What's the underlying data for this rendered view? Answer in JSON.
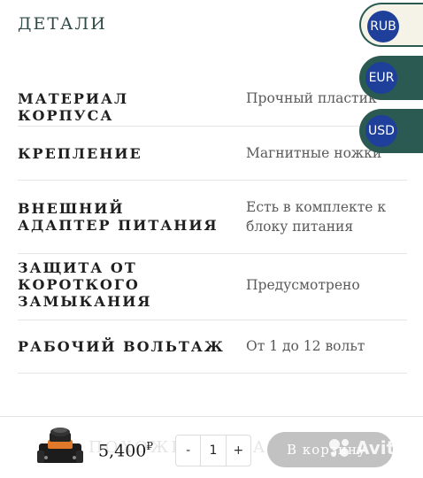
{
  "section": {
    "title": "ДЕТАЛИ"
  },
  "details": [
    {
      "label": "МАТЕРИАЛ КОРПУСА",
      "value": "Прочный пластик"
    },
    {
      "label": "КРЕПЛЕНИЕ",
      "value": "Магнитные ножки"
    },
    {
      "label": "ВНЕШНИЙ АДАПТЕР ПИТАНИЯ",
      "value": "Есть в комплекте к блоку питания"
    },
    {
      "label": "ЗАЩИТА ОТ КОРОТКОГО ЗАМЫКАНИЯ",
      "value": "Предусмотрено"
    },
    {
      "label": "РАБОЧИЙ ВОЛЬТАЖ",
      "value": "От 1 до 12 вольт"
    }
  ],
  "currencies": {
    "rub": "RUB",
    "eur": "EUR",
    "usd": "USD",
    "selected": "RUB"
  },
  "bottom_bar": {
    "price": "5,400",
    "currency_symbol": "₽",
    "decrement": "-",
    "quantity": "1",
    "increment": "+",
    "cart_label": "В корзину",
    "background_text": "ПОХОЖИЕ ТОВАРЫ"
  },
  "watermark": {
    "text": "Avito",
    "icon": "avito-logo-icon"
  },
  "colors": {
    "accent": "#2a5a52",
    "coin": "#1e3f9a",
    "cart_button": "#c2c2c2"
  }
}
